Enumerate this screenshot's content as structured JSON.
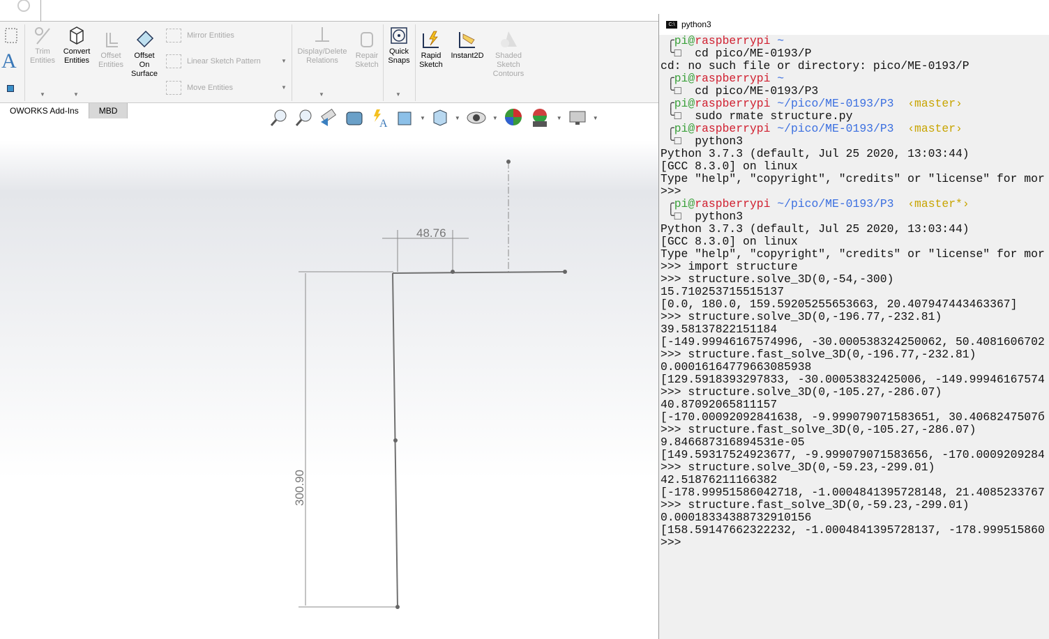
{
  "toolbar": {
    "trim": "Trim\nEntities",
    "convert": "Convert\nEntities",
    "offset": "Offset\nEntities",
    "offset_surface": "Offset\nOn\nSurface",
    "mirror": "Mirror Entities",
    "linear_pattern": "Linear Sketch Pattern",
    "move": "Move Entities",
    "display_delete": "Display/Delete\nRelations",
    "repair": "Repair\nSketch",
    "quick_snaps": "Quick\nSnaps",
    "rapid_sketch": "Rapid\nSketch",
    "instant2d": "Instant2D",
    "shaded": "Shaded\nSketch\nContours"
  },
  "tabs": [
    {
      "label": "OWORKS Add-Ins"
    },
    {
      "label": "MBD"
    }
  ],
  "sketch": {
    "dim_horizontal": "48.76",
    "dim_vertical": "300.90"
  },
  "terminal": {
    "title": "python3",
    "colors": {
      "green": "#3aa03a",
      "red": "#d01f2f",
      "blue": "#3b6fe0",
      "yellow": "#c8a400",
      "text": "#111111"
    },
    "lines": [
      {
        "p": true,
        "user": "pi",
        "host": "raspberrypi",
        "path": " ~",
        "branch": ""
      },
      {
        "cmd": "cd pico/ME-0193/P"
      },
      {
        "t": "cd: no such file or directory: pico/ME-0193/P"
      },
      {
        "p": true,
        "user": "pi",
        "host": "raspberrypi",
        "path": " ~",
        "branch": ""
      },
      {
        "cmd": "cd pico/ME-0193/P3"
      },
      {
        "p": true,
        "user": "pi",
        "host": "raspberrypi",
        "path": " ~/pico/ME-0193/P3",
        "branch": "  ‹master›"
      },
      {
        "cmd": "sudo rmate structure.py"
      },
      {
        "p": true,
        "user": "pi",
        "host": "raspberrypi",
        "path": " ~/pico/ME-0193/P3",
        "branch": "  ‹master›"
      },
      {
        "cmd": "python3"
      },
      {
        "t": "Python 3.7.3 (default, Jul 25 2020, 13:03:44)"
      },
      {
        "t": "[GCC 8.3.0] on linux"
      },
      {
        "t": "Type \"help\", \"copyright\", \"credits\" or \"license\" for mor"
      },
      {
        "t": ">>>"
      },
      {
        "p": true,
        "user": "pi",
        "host": "raspberrypi",
        "path": " ~/pico/ME-0193/P3",
        "branch": "  ‹master*›"
      },
      {
        "cmd": "python3"
      },
      {
        "t": "Python 3.7.3 (default, Jul 25 2020, 13:03:44)"
      },
      {
        "t": "[GCC 8.3.0] on linux"
      },
      {
        "t": "Type \"help\", \"copyright\", \"credits\" or \"license\" for mor"
      },
      {
        "t": ">>> import structure"
      },
      {
        "t": ">>> structure.solve_3D(0,-54,-300)"
      },
      {
        "t": "15.710253715515137"
      },
      {
        "t": "[0.0, 180.0, 159.5920525565366З, 20.407947443463367]"
      },
      {
        "t": ">>> structure.solve_3D(0,-196.77,-232.81)"
      },
      {
        "t": "39.58137822151184"
      },
      {
        "t": "[-149.99946167574996, -30.000538324250062, 50.4081606702"
      },
      {
        "t": ">>> structure.fast_solve_3D(0,-196.77,-232.81)"
      },
      {
        "t": "0.00016164779663085938"
      },
      {
        "t": "[129.5918393297833, -30.00053832425006, -149.99946167574"
      },
      {
        "t": ">>> structure.solve_3D(0,-105.27,-286.07)"
      },
      {
        "t": "40.87092065811157"
      },
      {
        "t": "[-170.00092092841638, -9.999079071583651, 30.4068247507б"
      },
      {
        "t": ">>> structure.fast_solve_3D(0,-105.27,-286.07)"
      },
      {
        "t": "9.846687316894531e-05"
      },
      {
        "t": "[149.59317524923677, -9.999079071583656, -170.0009209284"
      },
      {
        "t": ">>> structure.solve_3D(0,-59.23,-299.01)"
      },
      {
        "t": "42.51876211166382"
      },
      {
        "t": "[-178.99951586042718, -1.0004841395728148, 21.4085233767"
      },
      {
        "t": ">>> structure.fast_solve_3D(0,-59.23,-299.01)"
      },
      {
        "t": "0.00018334388732910156"
      },
      {
        "t": "[158.59147662322232, -1.0004841395728137, -178.999515860"
      },
      {
        "t": ">>>"
      }
    ]
  }
}
